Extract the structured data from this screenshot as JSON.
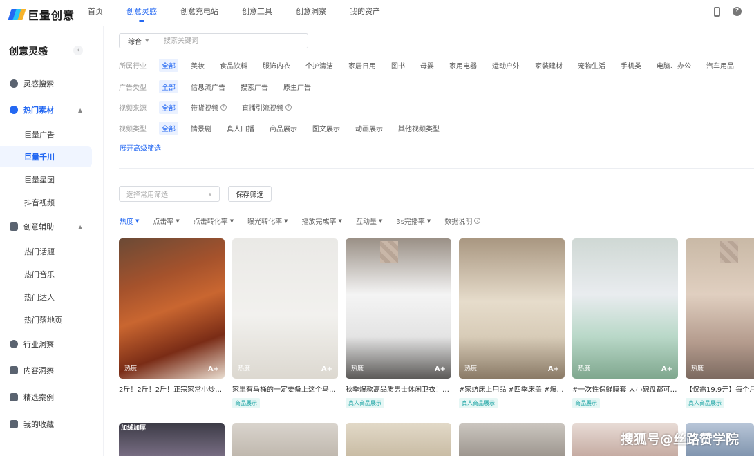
{
  "brand": {
    "logo_text": "巨量创意"
  },
  "nav": {
    "items": [
      "首页",
      "创意灵感",
      "创意充电站",
      "创意工具",
      "创意洞察",
      "我的资产"
    ]
  },
  "sidebar": {
    "title": "创意灵感",
    "collapse": "‹",
    "items": [
      {
        "label": "灵感搜索"
      },
      {
        "label": "热门素材"
      },
      {
        "label": "巨量广告"
      },
      {
        "label": "巨量千川"
      },
      {
        "label": "巨量星图"
      },
      {
        "label": "抖音视频"
      },
      {
        "label": "创意辅助"
      },
      {
        "label": "热门话题"
      },
      {
        "label": "热门音乐"
      },
      {
        "label": "热门达人"
      },
      {
        "label": "热门落地页"
      },
      {
        "label": "行业洞察"
      },
      {
        "label": "内容洞察"
      },
      {
        "label": "精选案例"
      },
      {
        "label": "我的收藏"
      }
    ]
  },
  "search": {
    "scope": "综合",
    "placeholder": "搜索关键词"
  },
  "filters": {
    "industry": {
      "label": "所属行业",
      "options": [
        "全部",
        "美妆",
        "食品饮料",
        "服饰内衣",
        "个护清洁",
        "家居日用",
        "图书",
        "母婴",
        "家用电器",
        "运动户外",
        "家装建材",
        "宠物生活",
        "手机类",
        "电脑、办公",
        "汽车用品"
      ]
    },
    "ad_type": {
      "label": "广告类型",
      "options": [
        "全部",
        "信息流广告",
        "搜索广告",
        "原生广告"
      ]
    },
    "video_source": {
      "label": "视频来源",
      "options": [
        "全部",
        "带货视频",
        "直播引流视频"
      ]
    },
    "video_type": {
      "label": "视频类型",
      "options": [
        "全部",
        "情景剧",
        "真人口播",
        "商品展示",
        "图文展示",
        "动画展示",
        "其他视频类型"
      ]
    },
    "expand": "展开高级筛选"
  },
  "preset": {
    "placeholder": "选择常用筛选",
    "save": "保存筛选"
  },
  "sort": {
    "items": [
      "热度",
      "点击率",
      "点击转化率",
      "曝光转化率",
      "播放完成率",
      "互动量",
      "3s完播率"
    ],
    "help": "数据说明"
  },
  "cards": [
    {
      "title": "2斤！2斤！2斤！正宗家常小炒…",
      "tag": "",
      "heat": "热度",
      "grade": "A+"
    },
    {
      "title": "家里有马桶的一定要备上这个马…",
      "tag": "商品展示",
      "heat": "热度",
      "grade": "A+"
    },
    {
      "title": "秋季爆款高品质男士休闲卫衣！…",
      "tag": "真人商品展示",
      "heat": "热度",
      "grade": "A+"
    },
    {
      "title": "#家纺床上用品 #四季床盖 #爆款…",
      "tag": "真人商品展示",
      "heat": "热度",
      "grade": "A+"
    },
    {
      "title": "#一次性保鲜膜套 大小碗盘都可…",
      "tag": "商品展示",
      "heat": "热度",
      "grade": "A+"
    },
    {
      "title": "【仅需19.9元】每个月",
      "tag": "真人商品展示",
      "heat": "热度",
      "grade": ""
    }
  ],
  "second_row": {
    "banner": "加绒加厚",
    "watermark": "搜狐号@丝路赞学院"
  },
  "icons": {
    "search": "search-icon",
    "fire": "fire-icon",
    "assist": "tools-icon",
    "industry": "compass-icon",
    "content": "content-icon",
    "case": "case-icon",
    "favorite": "star-icon"
  },
  "colors": {
    "accent": "#2468f2",
    "tag_text": "#1aa3a3"
  }
}
